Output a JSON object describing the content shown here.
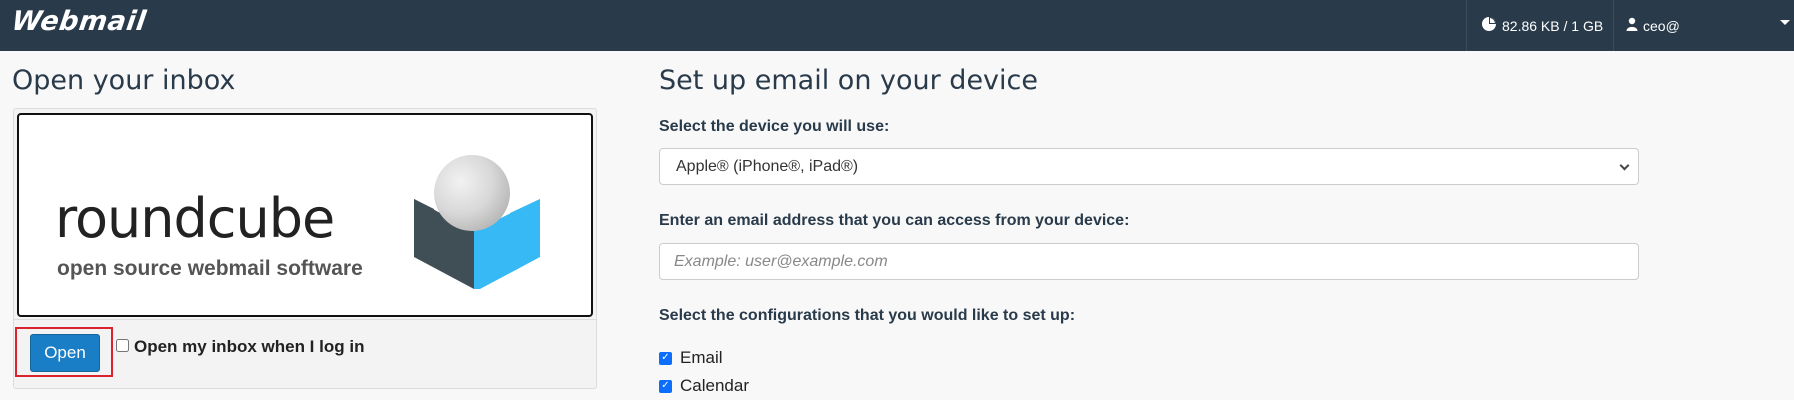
{
  "header": {
    "brand": "Webmail",
    "usage_icon": "pie-chart-icon",
    "usage_text": "82.86 KB / 1 GB",
    "user_icon": "user-icon",
    "user_name": "ceo@"
  },
  "left": {
    "title": "Open your inbox",
    "logo": {
      "name": "roundcube",
      "tagline": "open source webmail software"
    },
    "open_button": "Open",
    "auto_open_label": "Open my inbox when I log in",
    "auto_open_checked": false
  },
  "right": {
    "title": "Set up email on your device",
    "device_label": "Select the device you will use:",
    "device_selected": "Apple® (iPhone®, iPad®)",
    "email_label": "Enter an email address that you can access from your device:",
    "email_placeholder": "Example: user@example.com",
    "config_label": "Select the configurations that you would like to set up:",
    "configs": [
      {
        "label": "Email",
        "checked": true
      },
      {
        "label": "Calendar",
        "checked": true
      }
    ]
  },
  "colors": {
    "topbar": "#293a4a",
    "button": "#1a7ec6",
    "highlight": "#d9242e",
    "checkbox": "#0d6efd",
    "cube_blue": "#36b9f4",
    "cube_dark": "#404e56"
  }
}
